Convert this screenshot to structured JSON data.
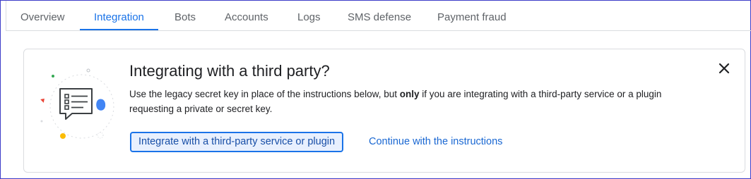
{
  "tabs": [
    {
      "label": "Overview",
      "active": false
    },
    {
      "label": "Integration",
      "active": true
    },
    {
      "label": "Bots",
      "active": false
    },
    {
      "label": "Accounts",
      "active": false
    },
    {
      "label": "Logs",
      "active": false
    },
    {
      "label": "SMS defense",
      "active": false
    },
    {
      "label": "Payment fraud",
      "active": false
    }
  ],
  "card": {
    "title": "Integrating with a third party?",
    "desc_before": "Use the legacy secret key in place of the instructions below, but ",
    "desc_bold": "only",
    "desc_after": " if you are integrating with a third-party service or a plugin requesting a private or secret key.",
    "primary_button": "Integrate with a third-party service or plugin",
    "link_button": "Continue with the instructions",
    "illustration_icon": "chat-list-icon",
    "close_icon": "close-icon"
  },
  "colors": {
    "accent": "#1a73e8",
    "tab_text": "#5f6368",
    "primary_button_bg": "#e8f0fe",
    "dot_green": "#34a853",
    "dot_red": "#ea4335",
    "dot_yellow": "#fbbc04",
    "dot_blue": "#4285f4"
  }
}
